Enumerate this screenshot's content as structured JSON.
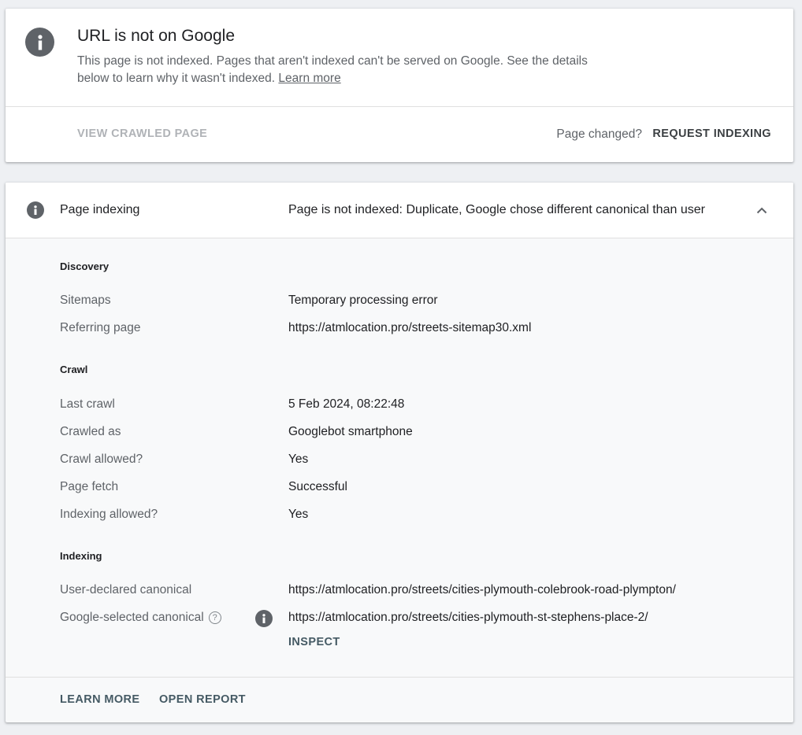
{
  "status": {
    "title": "URL is not on Google",
    "description": "This page is not indexed. Pages that aren't indexed can't be served on Google. See the details below to learn why it wasn't indexed.",
    "learn_more_link": "Learn more",
    "view_crawled_label": "VIEW CRAWLED PAGE",
    "page_changed_text": "Page changed?",
    "request_indexing_label": "REQUEST INDEXING"
  },
  "indexing": {
    "header_label": "Page indexing",
    "header_value": "Page is not indexed: Duplicate, Google chose different canonical than user",
    "sections": {
      "discovery": {
        "title": "Discovery",
        "sitemaps_label": "Sitemaps",
        "sitemaps_value": "Temporary processing error",
        "referring_label": "Referring page",
        "referring_value": "https://atmlocation.pro/streets-sitemap30.xml"
      },
      "crawl": {
        "title": "Crawl",
        "last_crawl_label": "Last crawl",
        "last_crawl_value": "5 Feb 2024, 08:22:48",
        "crawled_as_label": "Crawled as",
        "crawled_as_value": "Googlebot smartphone",
        "crawl_allowed_label": "Crawl allowed?",
        "crawl_allowed_value": "Yes",
        "page_fetch_label": "Page fetch",
        "page_fetch_value": "Successful",
        "indexing_allowed_label": "Indexing allowed?",
        "indexing_allowed_value": "Yes"
      },
      "indexing": {
        "title": "Indexing",
        "user_canonical_label": "User-declared canonical",
        "user_canonical_value": "https://atmlocation.pro/streets/cities-plymouth-colebrook-road-plympton/",
        "google_canonical_label": "Google-selected canonical",
        "google_canonical_value": "https://atmlocation.pro/streets/cities-plymouth-st-stephens-place-2/",
        "inspect_label": "INSPECT"
      }
    },
    "footer": {
      "learn_more_label": "LEARN MORE",
      "open_report_label": "OPEN REPORT"
    }
  },
  "icons": {
    "info": "info-icon",
    "help": "help-circle-icon",
    "chevron": "chevron-up-icon"
  },
  "colors": {
    "background": "#eef0f3",
    "icon_gray": "#5f6368",
    "action_blue_gray": "#455a64",
    "disabled": "#b0b3b7"
  }
}
